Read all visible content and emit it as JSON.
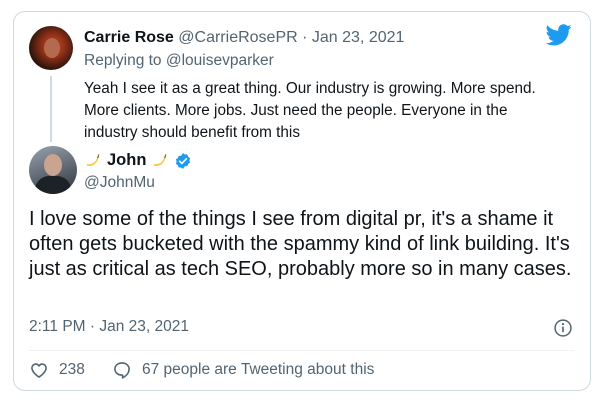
{
  "reply": {
    "name": "Carrie Rose",
    "handle": "@CarrieRosePR",
    "separator": "·",
    "date": "Jan 23, 2021",
    "replying_prefix": "Replying to ",
    "replying_to": "@louisevparker",
    "text": "Yeah I see it as a great thing. Our industry is growing. More spend. More clients. More jobs. Just need the people. Everyone in the industry should benefit from this"
  },
  "tweet": {
    "author_name": "John",
    "author_handle": "@JohnMu",
    "text": "I love some of the things I see from digital pr, it's a shame it often gets bucketed with the spammy kind of link building. It's just as critical as tech SEO, probably more so in many cases.",
    "timestamp": "2:11 PM · Jan 23, 2021"
  },
  "actions": {
    "likes": "238",
    "talking": "67 people are Tweeting about this"
  },
  "icons": {
    "brand": "twitter-bird-icon",
    "verified": "verified-badge-icon",
    "emoji": "banana-icon",
    "info": "info-icon",
    "like": "heart-icon",
    "talk": "speech-bubble-icon"
  },
  "colors": {
    "brand_blue": "#1d9bf0",
    "muted_text": "#536471",
    "banana": "#f6c945"
  }
}
